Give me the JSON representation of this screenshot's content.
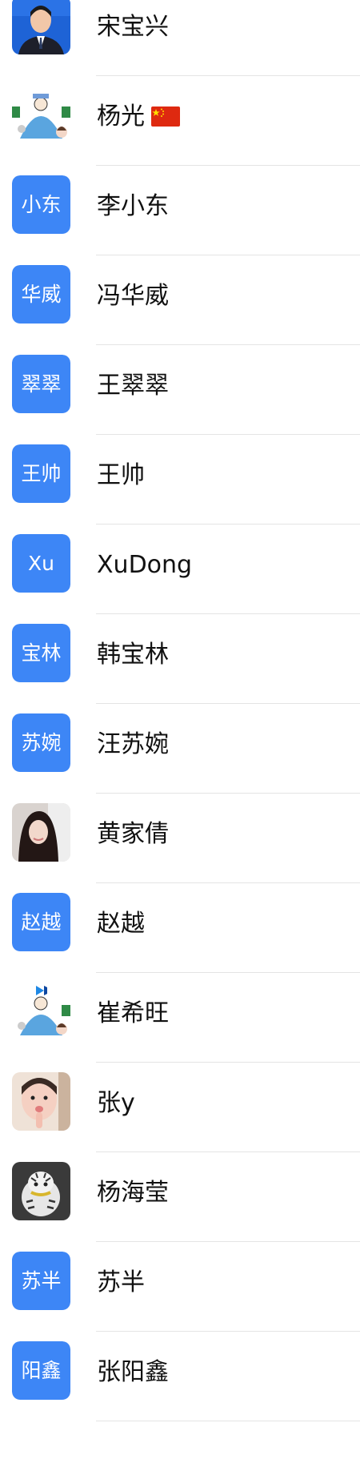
{
  "contacts": [
    {
      "name": "宋宝兴",
      "avatar_type": "photo",
      "avatar_icon": "man-suit-portrait"
    },
    {
      "name": "杨光",
      "avatar_type": "illustration",
      "avatar_icon": "cartoon-scene",
      "flag": "china-flag-icon"
    },
    {
      "name": "李小东",
      "avatar_type": "text",
      "avatar_text": "小东"
    },
    {
      "name": "冯华威",
      "avatar_type": "text",
      "avatar_text": "华威"
    },
    {
      "name": "王翠翠",
      "avatar_type": "text",
      "avatar_text": "翠翠"
    },
    {
      "name": "王帅",
      "avatar_type": "text",
      "avatar_text": "王帅"
    },
    {
      "name": "XuDong",
      "avatar_type": "text",
      "avatar_text": "Xu"
    },
    {
      "name": "韩宝林",
      "avatar_type": "text",
      "avatar_text": "宝林"
    },
    {
      "name": "汪苏婉",
      "avatar_type": "text",
      "avatar_text": "苏婉"
    },
    {
      "name": "黄家倩",
      "avatar_type": "photo",
      "avatar_icon": "woman-portrait"
    },
    {
      "name": "赵越",
      "avatar_type": "text",
      "avatar_text": "赵越"
    },
    {
      "name": "崔希旺",
      "avatar_type": "illustration",
      "avatar_icon": "cartoon-scene-code-logo"
    },
    {
      "name": "张y",
      "avatar_type": "photo",
      "avatar_icon": "child-portrait"
    },
    {
      "name": "杨海莹",
      "avatar_type": "photo",
      "avatar_icon": "tiger-toy"
    },
    {
      "name": "苏半",
      "avatar_type": "text",
      "avatar_text": "苏半"
    },
    {
      "name": "张阳鑫",
      "avatar_type": "text",
      "avatar_text": "阳鑫"
    }
  ],
  "colors": {
    "avatar_blue": "#3d86f6",
    "separator": "#e4e4e4",
    "name_text": "#111111"
  }
}
